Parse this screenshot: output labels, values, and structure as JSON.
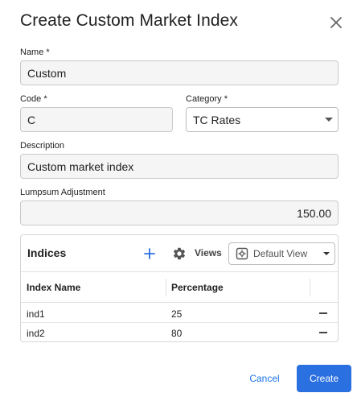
{
  "dialog": {
    "title": "Create Custom Market Index",
    "close_icon": "close-icon"
  },
  "form": {
    "name": {
      "label": "Name *",
      "value": "Custom"
    },
    "code": {
      "label": "Code *",
      "value": "C"
    },
    "category": {
      "label": "Category *",
      "value": "TC Rates",
      "icon": "chevron-down-icon"
    },
    "description": {
      "label": "Description",
      "value": "Custom market index"
    },
    "lumpsum": {
      "label": "Lumpsum Adjustment",
      "value": "150.00"
    }
  },
  "indices": {
    "title": "Indices",
    "add_icon": "plus-icon",
    "settings_icon": "gear-icon",
    "views_label": "Views",
    "view_select": {
      "value": "Default View",
      "icon": "view-settings-icon"
    },
    "columns": [
      "Index Name",
      "Percentage"
    ],
    "rows": [
      {
        "name": "ind1",
        "percentage": "25"
      },
      {
        "name": "ind2",
        "percentage": "80"
      }
    ],
    "remove_icon": "minus-icon"
  },
  "footer": {
    "cancel_label": "Cancel",
    "create_label": "Create"
  },
  "colors": {
    "primary": "#2b70e0",
    "link": "#1a73e8",
    "field_bg": "#f5f5f5",
    "border": "#c9c9c9"
  }
}
